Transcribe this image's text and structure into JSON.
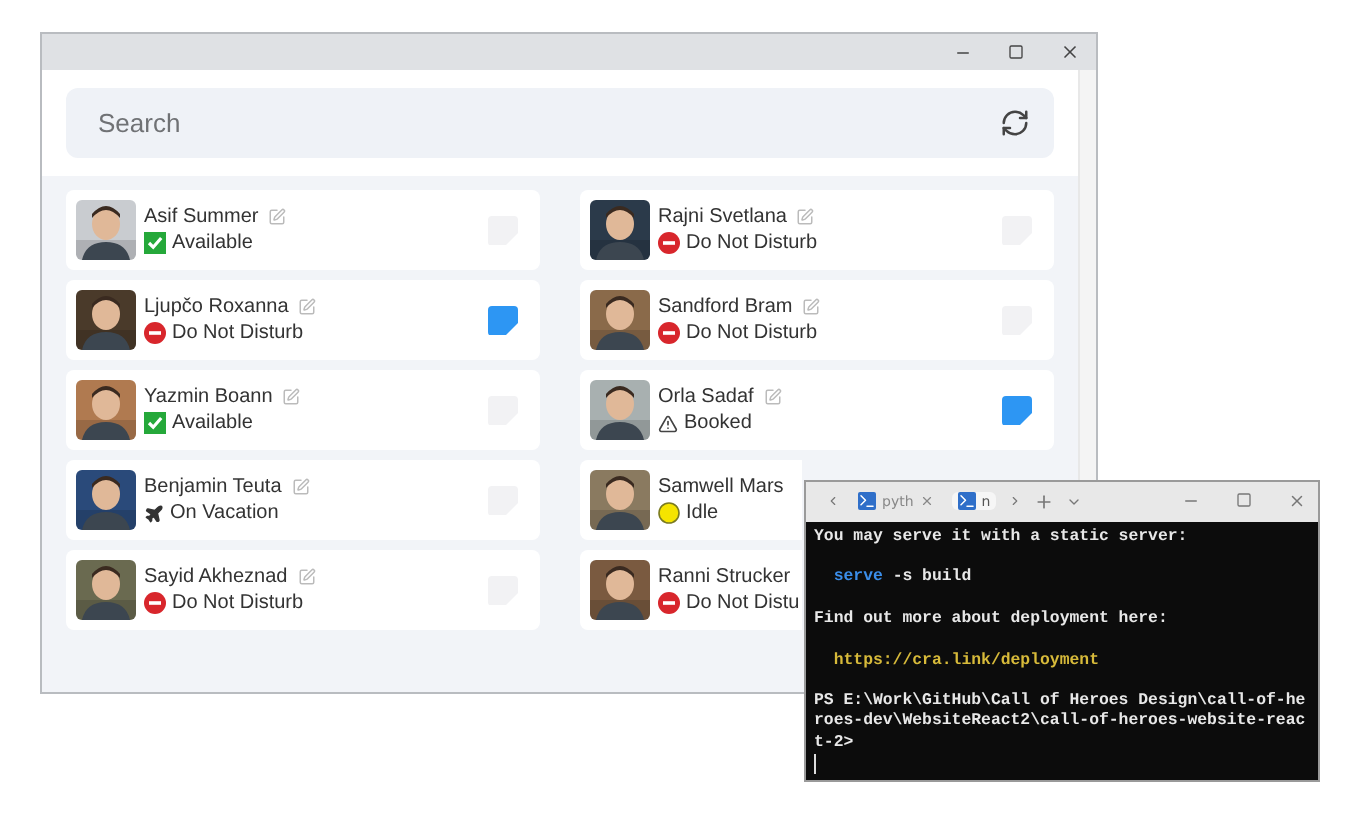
{
  "main_window": {
    "search": {
      "placeholder": "Search"
    },
    "contacts": [
      {
        "name": "Asif Summer",
        "status": {
          "kind": "available",
          "label": "Available"
        },
        "note": {
          "active": false
        }
      },
      {
        "name": "Rajni Svetlana",
        "status": {
          "kind": "dnd",
          "label": "Do Not Disturb"
        },
        "note": {
          "active": false
        }
      },
      {
        "name": "Ljupčo Roxanna",
        "status": {
          "kind": "dnd",
          "label": "Do Not Disturb"
        },
        "note": {
          "active": true
        }
      },
      {
        "name": "Sandford Bram",
        "status": {
          "kind": "dnd",
          "label": "Do Not Disturb"
        },
        "note": {
          "active": false
        }
      },
      {
        "name": "Yazmin Boann",
        "status": {
          "kind": "available",
          "label": "Available"
        },
        "note": {
          "active": false
        }
      },
      {
        "name": "Orla Sadaf",
        "status": {
          "kind": "booked",
          "label": "Booked"
        },
        "note": {
          "active": true
        }
      },
      {
        "name": "Benjamin Teuta",
        "status": {
          "kind": "vacation",
          "label": "On Vacation"
        },
        "note": {
          "active": false
        }
      },
      {
        "name": "Samwell Mars",
        "status": {
          "kind": "idle",
          "label": "Idle"
        }
      },
      {
        "name": "Sayid Akheznad",
        "status": {
          "kind": "dnd",
          "label": "Do Not Disturb"
        },
        "note": {
          "active": false
        }
      },
      {
        "name": "Ranni Strucker",
        "status": {
          "kind": "dnd",
          "label": "Do Not Distu"
        }
      }
    ]
  },
  "terminal": {
    "tabs": [
      {
        "label": "pyth",
        "selected": false,
        "closable": true
      },
      {
        "label": "n",
        "selected": true,
        "closable": false
      }
    ],
    "lines": [
      {
        "kind": "text",
        "text": "You may serve it with a static server:"
      },
      {
        "kind": "blank"
      },
      {
        "kind": "command",
        "command": "serve",
        "args": " -s build"
      },
      {
        "kind": "blank"
      },
      {
        "kind": "text",
        "text": "Find out more about deployment here:"
      },
      {
        "kind": "blank"
      },
      {
        "kind": "link",
        "text": "https://cra.link/deployment"
      },
      {
        "kind": "blank"
      },
      {
        "kind": "text",
        "text": "PS E:\\Work\\GitHub\\Call of Heroes Design\\call-of-he"
      },
      {
        "kind": "text",
        "text": "roes-dev\\WebsiteReact2\\call-of-heroes-website-reac"
      },
      {
        "kind": "text",
        "text": "t-2>"
      },
      {
        "kind": "cursor"
      }
    ]
  }
}
